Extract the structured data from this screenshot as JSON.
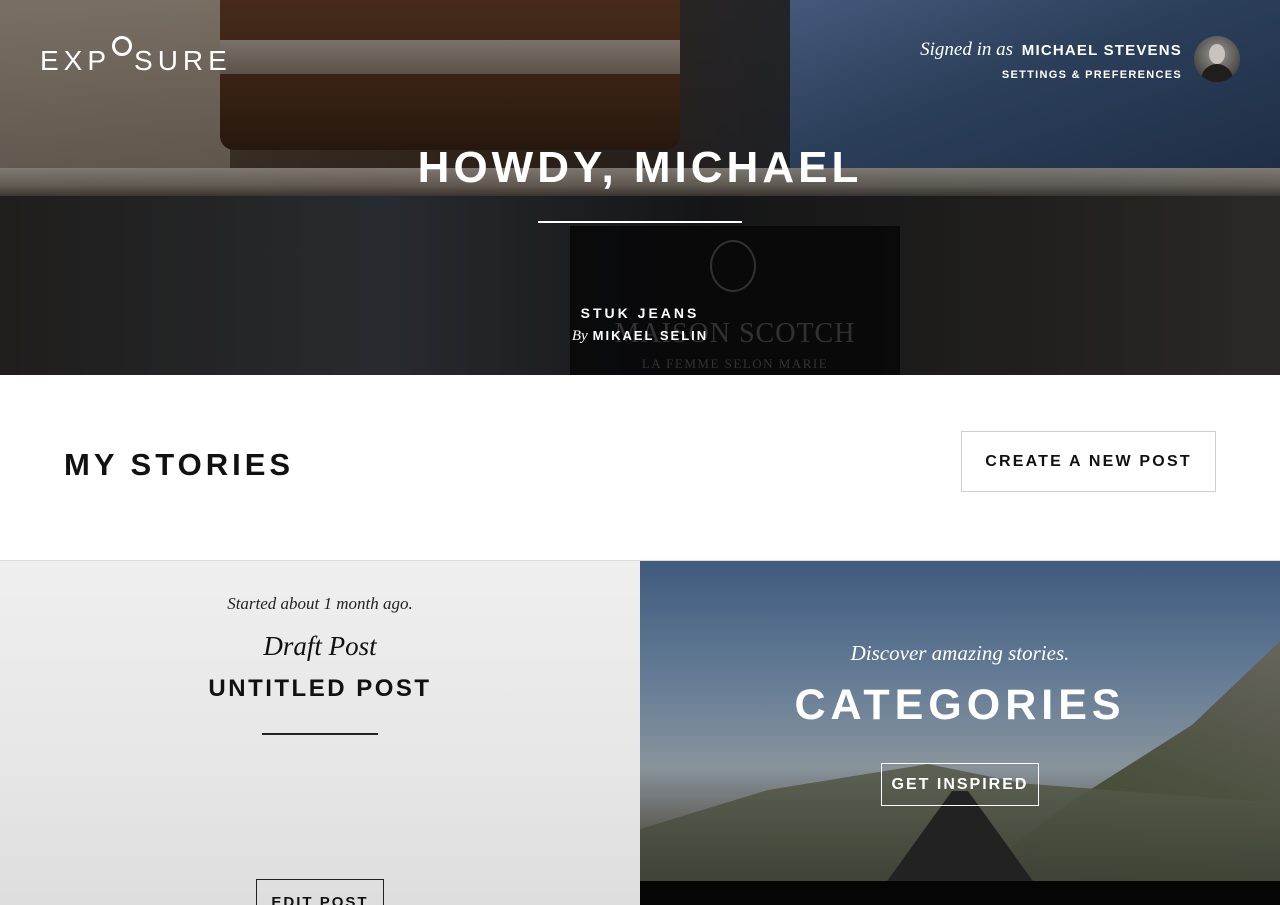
{
  "header": {
    "logo_prefix": "EXP",
    "logo_suffix": "SURE",
    "signed_in_prefix": "Signed in as",
    "user_name": "MICHAEL STEVENS",
    "settings_link": "SETTINGS & PREFERENCES"
  },
  "hero": {
    "greeting": "HOWDY, MICHAEL",
    "featured_story_title": "STUK JEANS",
    "featured_by_prefix": "By",
    "featured_author": "MIKAEL SELIN",
    "background_sign_text": "MAISON SCOTCH",
    "background_sign_subtext": "LA FEMME SELON MARIE"
  },
  "stories": {
    "title": "MY STORIES",
    "create_button": "CREATE A NEW POST"
  },
  "draft_card": {
    "started": "Started about 1 month ago.",
    "label": "Draft Post",
    "post_title": "UNTITLED POST",
    "edit_button": "EDIT POST"
  },
  "categories_card": {
    "tagline": "Discover amazing stories.",
    "title": "CATEGORIES",
    "button": "GET INSPIRED"
  },
  "colors": {
    "text_dark": "#111111",
    "card_gray": "#eeeeee",
    "white": "#ffffff"
  }
}
